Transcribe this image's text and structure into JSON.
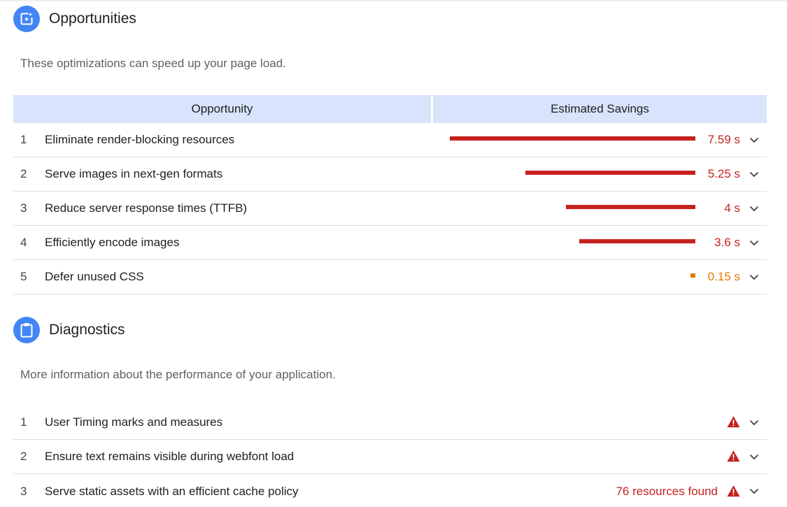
{
  "colors": {
    "accent": "#4285f4",
    "fail": "#c5221f",
    "average": "#e67700",
    "header_bg": "#d7e4fb"
  },
  "opportunities": {
    "icon": "opportunity-icon",
    "title": "Opportunities",
    "description": "These optimizations can speed up your page load.",
    "header": {
      "opportunity": "Opportunity",
      "savings": "Estimated Savings"
    },
    "max_savings_s": 7.59,
    "rows": [
      {
        "num": "1",
        "title": "Eliminate render-blocking resources",
        "value": "7.59 s",
        "savings_s": 7.59,
        "status": "fail"
      },
      {
        "num": "2",
        "title": "Serve images in next-gen formats",
        "value": "5.25 s",
        "savings_s": 5.25,
        "status": "fail"
      },
      {
        "num": "3",
        "title": "Reduce server response times (TTFB)",
        "value": "4 s",
        "savings_s": 4.0,
        "status": "fail"
      },
      {
        "num": "4",
        "title": "Efficiently encode images",
        "value": "3.6 s",
        "savings_s": 3.6,
        "status": "fail"
      },
      {
        "num": "5",
        "title": "Defer unused CSS",
        "value": "0.15 s",
        "savings_s": 0.15,
        "status": "average"
      }
    ]
  },
  "diagnostics": {
    "icon": "clipboard-icon",
    "title": "Diagnostics",
    "description": "More information about the performance of your application.",
    "rows": [
      {
        "num": "1",
        "title": "User Timing marks and measures",
        "display": "",
        "icon": "warning-icon"
      },
      {
        "num": "2",
        "title": "Ensure text remains visible during webfont load",
        "display": "",
        "icon": "warning-icon"
      },
      {
        "num": "3",
        "title": "Serve static assets with an efficient cache policy",
        "display": "76 resources found",
        "icon": "warning-icon"
      }
    ]
  }
}
